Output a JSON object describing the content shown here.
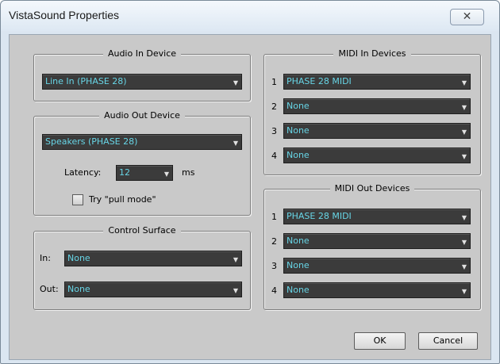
{
  "window": {
    "title": "VistaSound Properties",
    "close_glyph": "✕"
  },
  "audio_in": {
    "legend": "Audio In Device",
    "device": "Line In (PHASE 28)"
  },
  "audio_out": {
    "legend": "Audio Out Device",
    "device": "Speakers (PHASE 28)",
    "latency_label": "Latency:",
    "latency_value": "12",
    "latency_unit": "ms",
    "pull_mode_label": "Try \"pull mode\"",
    "pull_mode_checked": false
  },
  "control_surface": {
    "legend": "Control Surface",
    "in_label": "In:",
    "in_value": "None",
    "out_label": "Out:",
    "out_value": "None"
  },
  "midi_in": {
    "legend": "MIDI In Devices",
    "rows": [
      {
        "num": "1",
        "value": "PHASE 28 MIDI"
      },
      {
        "num": "2",
        "value": "None"
      },
      {
        "num": "3",
        "value": "None"
      },
      {
        "num": "4",
        "value": "None"
      }
    ]
  },
  "midi_out": {
    "legend": "MIDI Out Devices",
    "rows": [
      {
        "num": "1",
        "value": "PHASE 28 MIDI"
      },
      {
        "num": "2",
        "value": "None"
      },
      {
        "num": "3",
        "value": "None"
      },
      {
        "num": "4",
        "value": "None"
      }
    ]
  },
  "buttons": {
    "ok": "OK",
    "cancel": "Cancel"
  },
  "icons": {
    "dropdown_arrow": "▼"
  },
  "colors": {
    "dropdown_bg": "#3b3b3b",
    "dropdown_text": "#67d5e6",
    "panel_bg": "#c9c9c9"
  }
}
